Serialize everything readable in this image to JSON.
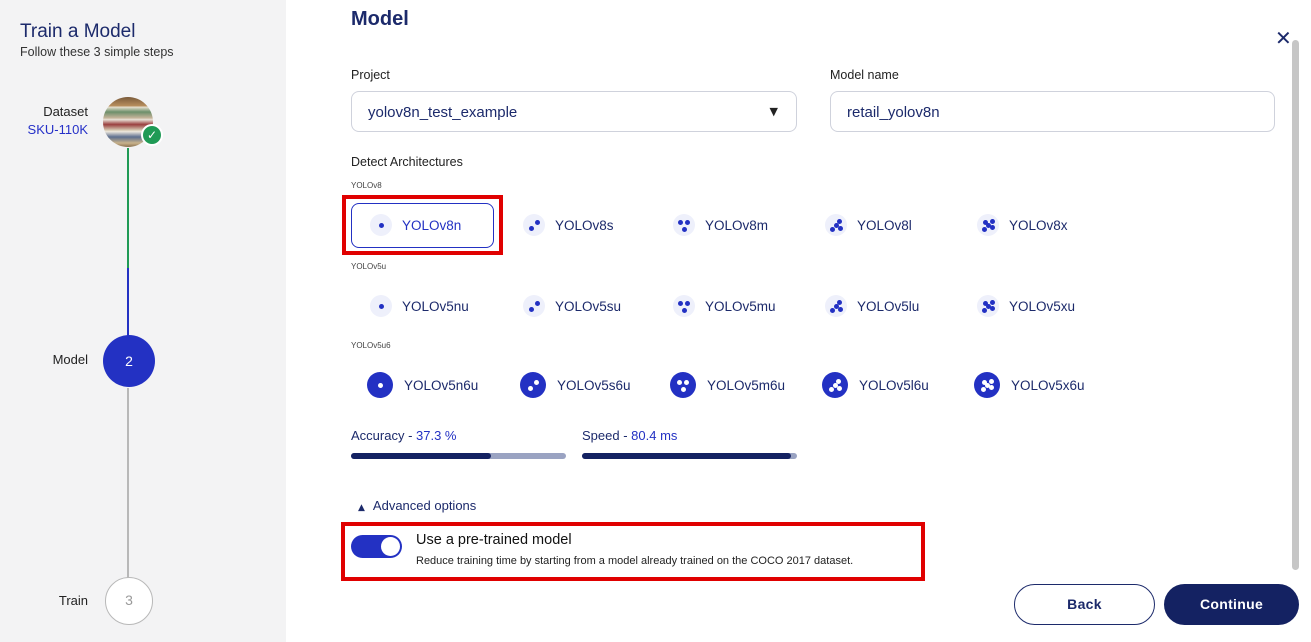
{
  "sidebar": {
    "title": "Train a Model",
    "subtitle": "Follow these 3 simple steps",
    "steps": [
      {
        "label": "Dataset",
        "value": "SKU-110K"
      },
      {
        "label": "Model",
        "number": "2"
      },
      {
        "label": "Train",
        "number": "3"
      }
    ]
  },
  "main": {
    "heading": "Model",
    "close": "✕",
    "project_label": "Project",
    "project_value": "yolov8n_test_example",
    "model_name_label": "Model name",
    "model_name_value": "retail_yolov8n",
    "detect_label": "Detect Architectures",
    "groups": [
      {
        "name": "YOLOv8",
        "items": [
          "YOLOv8n",
          "YOLOv8s",
          "YOLOv8m",
          "YOLOv8l",
          "YOLOv8x"
        ]
      },
      {
        "name": "YOLOv5u",
        "items": [
          "YOLOv5nu",
          "YOLOv5su",
          "YOLOv5mu",
          "YOLOv5lu",
          "YOLOv5xu"
        ]
      },
      {
        "name": "YOLOv5u6",
        "items": [
          "YOLOv5n6u",
          "YOLOv5s6u",
          "YOLOv5m6u",
          "YOLOv5l6u",
          "YOLOv5x6u"
        ]
      }
    ],
    "selected": "YOLOv8n",
    "accuracy_label": "Accuracy - ",
    "accuracy_value": "37.3 %",
    "accuracy_fraction": 0.65,
    "speed_label": "Speed - ",
    "speed_value": "80.4 ms",
    "speed_fraction": 0.97,
    "advanced_label": "Advanced options",
    "pretrained_title": "Use a pre-trained model",
    "pretrained_desc": "Reduce training time by starting from a model already trained on the COCO 2017 dataset.",
    "pretrained_on": true,
    "back_label": "Back",
    "continue_label": "Continue"
  },
  "colors": {
    "accent": "#2331c3",
    "navy": "#142262",
    "highlight": "#e00000",
    "success": "#1f9a55"
  }
}
